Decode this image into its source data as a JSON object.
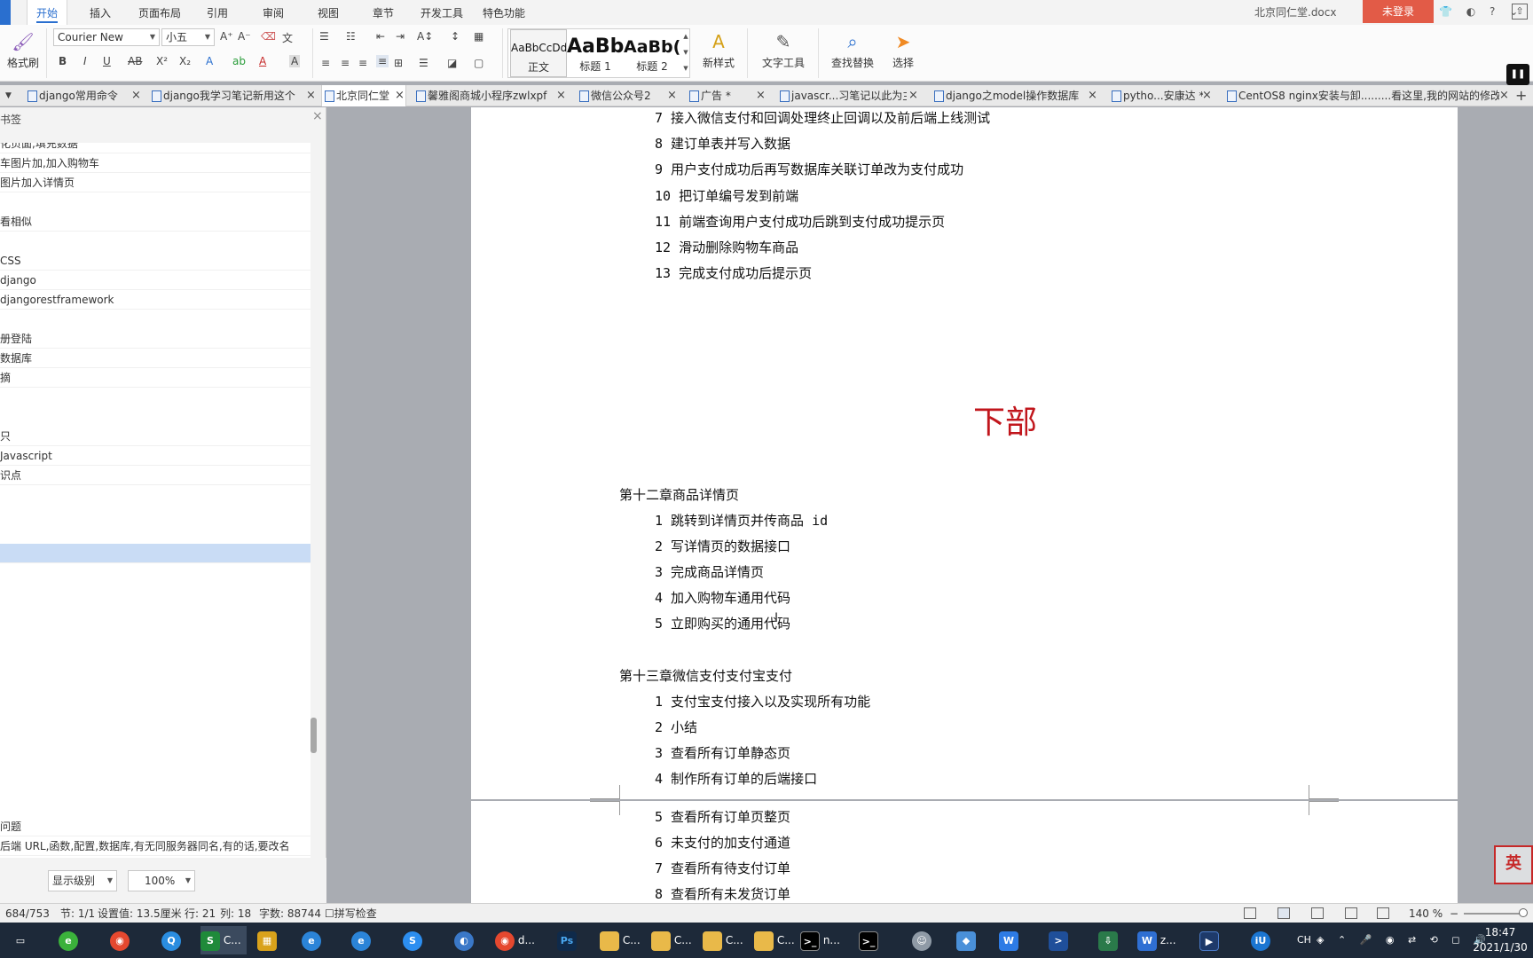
{
  "menubar": {
    "tabs": [
      "开始",
      "插入",
      "页面布局",
      "引用",
      "审阅",
      "视图",
      "章节",
      "开发工具",
      "特色功能"
    ],
    "doc_title": "北京同仁堂.docx",
    "login": "未登录",
    "colors": {
      "accent": "#2a6fcf",
      "login": "#e25b47"
    }
  },
  "ribbon": {
    "format_painter": "格式刷",
    "font_name": "Courier New",
    "font_size": "小五",
    "styles": [
      {
        "preview": "AaBbCcDd",
        "name": "正文"
      },
      {
        "preview": "AaBb",
        "name": "标题 1"
      },
      {
        "preview": "AaBb(",
        "name": "标题 2"
      }
    ],
    "new_style": "新样式",
    "text_tool": "文字工具",
    "find_replace": "查找替换",
    "select": "选择"
  },
  "doc_tabs": [
    {
      "label": "django常用命令",
      "active": false
    },
    {
      "label": "django我学习笔记新用这个",
      "active": false
    },
    {
      "label": "北京同仁堂",
      "active": true
    },
    {
      "label": "馨雅阁商城小程序zwlxpf",
      "active": false
    },
    {
      "label": "微信公众号2",
      "active": false
    },
    {
      "label": "广告 *",
      "active": false
    },
    {
      "label": "javascr...习笔记以此为主",
      "active": false
    },
    {
      "label": "django之model操作数据库",
      "active": false
    },
    {
      "label": "pytho...安康达 *",
      "active": false
    },
    {
      "label": "CentOS8 nginx安装与卸.........看这里,我的网站的修改",
      "active": false
    }
  ],
  "bookmarks": {
    "title": "书签",
    "items": [
      {
        "text": "化页面,填充数据",
        "row": 0
      },
      {
        "text": "车图片加,加入购物车",
        "row": 1
      },
      {
        "text": "图片加入详情页",
        "row": 2
      },
      {
        "text": "看相似",
        "row": 4
      },
      {
        "text": "CSS",
        "row": 6
      },
      {
        "text": "django",
        "row": 7
      },
      {
        "text": "djangorestframework",
        "row": 8
      },
      {
        "text": "册登陆",
        "row": 10
      },
      {
        "text": "数据库",
        "row": 11
      },
      {
        "text": "摘",
        "row": 12
      },
      {
        "text": "只",
        "row": 15
      },
      {
        "text": "Javascript",
        "row": 16
      },
      {
        "text": "识点",
        "row": 17
      },
      {
        "text": "",
        "row": 21,
        "selected": true
      },
      {
        "text": "问题",
        "row": 35
      },
      {
        "text": "后端 URL,函数,配置,数据库,有无同服务器同名,有的话,要改名",
        "row": 36
      }
    ],
    "display_level": "显示级别",
    "zoom": "100%"
  },
  "document": {
    "top_items": [
      "7 接入微信支付和回调处理终止回调以及前后端上线测试",
      "8 建订单表并写入数据",
      "9 用户支付成功后再写数据库关联订单改为支付成功",
      "10 把订单编号发到前端",
      "11 前端查询用户支付成功后跳到支付成功提示页",
      "12 滑动删除购物车商品",
      "13 完成支付成功后提示页"
    ],
    "section_heading": "下部",
    "chapter12": {
      "title": "第十二章商品详情页",
      "items": [
        "1 跳转到详情页并传商品 id",
        "2 写详情页的数据接口",
        "3 完成商品详情页",
        "4 加入购物车通用代码",
        "5 立即购买的通用代码"
      ]
    },
    "chapter13": {
      "title": "第十三章微信支付支付宝支付",
      "items": [
        "1 支付宝支付接入以及实现所有功能",
        "2 小结",
        "3 查看所有订单静态页",
        "4 制作所有订单的后端接口"
      ],
      "next_page_items": [
        "5 查看所有订单页整页",
        "6 未支付的加支付通道",
        "7 查看所有待支付订单",
        "8 查看所有未发货订单"
      ]
    },
    "heading_color": "#c1161c",
    "ime_badge": "英"
  },
  "status": {
    "page": "684/753",
    "section": "节: 1/1",
    "setting": "设置值: 13.5厘米",
    "row": "行: 21",
    "col": "列: 18",
    "words": "字数: 88744",
    "spell": "拼写检查",
    "zoom": "140 %"
  },
  "taskbar": {
    "items": [
      {
        "label": "C...",
        "icon": "spreadsheet-icon"
      },
      {
        "label": "d...",
        "icon": "chrome-icon"
      },
      {
        "label": "C...",
        "icon": "folder-icon"
      },
      {
        "label": "C...",
        "icon": "folder-icon"
      },
      {
        "label": "C...",
        "icon": "folder-icon"
      },
      {
        "label": "C...",
        "icon": "folder-icon"
      },
      {
        "label": "n...",
        "icon": "terminal-icon"
      },
      {
        "label": "z...",
        "icon": "wps-icon"
      }
    ],
    "ime": "CH",
    "time": "18:47",
    "date": "2021/1/30"
  }
}
